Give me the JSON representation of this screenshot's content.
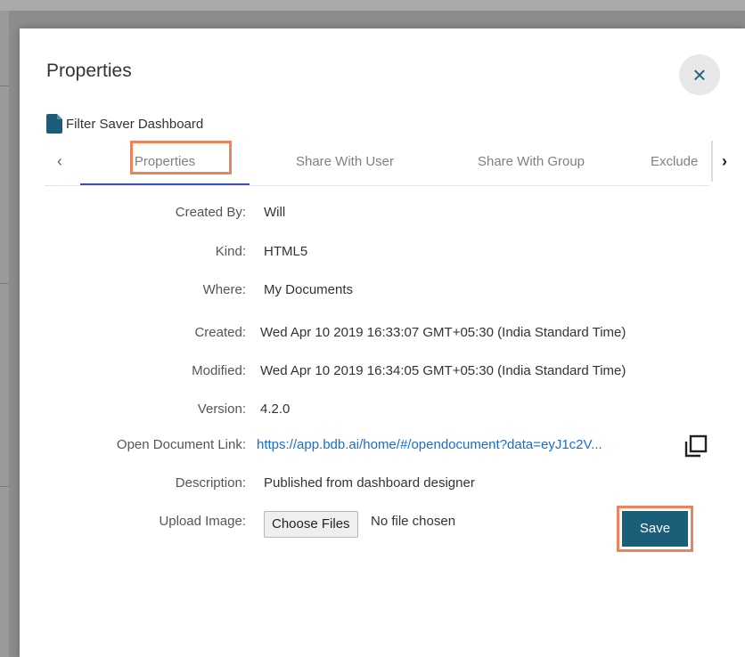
{
  "dialog": {
    "title": "Properties",
    "close_symbol": "×",
    "document_name": "Filter Saver Dashboard",
    "document_icon": "file-icon"
  },
  "tabs": {
    "prev_symbol": "‹",
    "next_symbol": "›",
    "items": [
      {
        "label": "Properties",
        "active": true
      },
      {
        "label": "Share With User"
      },
      {
        "label": "Share With Group"
      },
      {
        "label": "Exclude"
      }
    ]
  },
  "properties": {
    "created_by": {
      "label": "Created By:",
      "value": "Will"
    },
    "kind": {
      "label": "Kind:",
      "value": "HTML5"
    },
    "where": {
      "label": "Where:",
      "value": "My Documents"
    },
    "created": {
      "label": "Created:",
      "value": "Wed Apr 10 2019 16:33:07 GMT+05:30 (India Standard Time)"
    },
    "modified": {
      "label": "Modified:",
      "value": "Wed Apr 10 2019 16:34:05 GMT+05:30 (India Standard Time)"
    },
    "version": {
      "label": "Version:",
      "value": "4.2.0"
    },
    "open_link": {
      "label": "Open Document Link:",
      "value": "https://app.bdb.ai/home/#/opendocument?data=eyJ1c2V..."
    },
    "description": {
      "label": "Description:",
      "value": "Published from dashboard designer"
    },
    "upload_image": {
      "label": "Upload Image:",
      "button": "Choose Files",
      "status": "No file chosen"
    }
  },
  "actions": {
    "save_label": "Save"
  },
  "colors": {
    "accent": "#1b5e78",
    "highlight": "#e8855c",
    "link": "#1b6ec2",
    "tab_active": "#3c4fb4"
  }
}
